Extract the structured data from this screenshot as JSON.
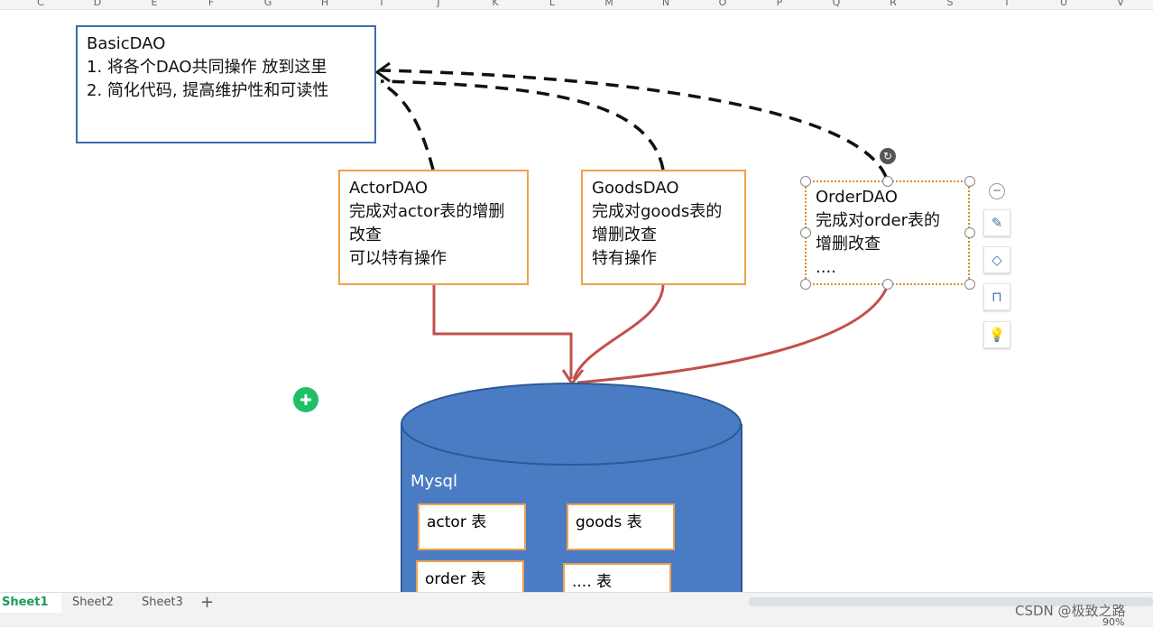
{
  "columns": [
    "C",
    "D",
    "E",
    "F",
    "G",
    "H",
    "I",
    "J",
    "K",
    "L",
    "M",
    "N",
    "O",
    "P",
    "Q",
    "R",
    "S",
    "T",
    "U",
    "V"
  ],
  "basic": {
    "title": "BasicDAO",
    "line1": "1. 将各个DAO共同操作 放到这里",
    "line2": "2.  简化代码, 提高维护性和可读性"
  },
  "actor": {
    "title": "ActorDAO",
    "line1": "完成对actor表的增删",
    "line2": "改查",
    "line3": "可以特有操作"
  },
  "goods": {
    "title": "GoodsDAO",
    "line1": "完成对goods表的",
    "line2": "增删改查",
    "line3": "特有操作"
  },
  "order": {
    "title": "OrderDAO",
    "line1": "完成对order表的",
    "line2": "增删改查",
    "line3": "...."
  },
  "db": {
    "label": "Mysql",
    "tables": [
      "actor 表",
      "goods 表",
      "order 表",
      ".... 表"
    ]
  },
  "sheets": [
    "Sheet1",
    "Sheet2",
    "Sheet3"
  ],
  "add_sheet": "+",
  "watermark": "CSDN @极致之路",
  "zoom": "90%",
  "colors": {
    "db": "#4a7cc4",
    "arrow": "#c0504d",
    "accent": "#1a9c5a"
  }
}
